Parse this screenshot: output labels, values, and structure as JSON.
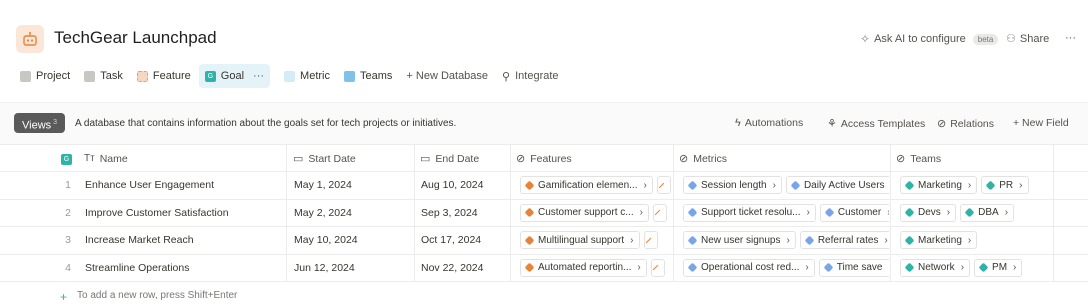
{
  "app": {
    "title": "TechGear Launchpad",
    "icon": "robot-icon"
  },
  "header": {
    "ask_ai": "Ask AI to configure",
    "beta": "beta",
    "share": "Share",
    "more": "···"
  },
  "tabs": [
    {
      "label": "Project",
      "color": "#c9c7c2"
    },
    {
      "label": "Task",
      "color": "#c9c7c2"
    },
    {
      "label": "Feature",
      "color": "#f0b99a"
    },
    {
      "label": "Goal",
      "color": "#2db3a8",
      "active": true,
      "more": "···"
    },
    {
      "label": "Metric",
      "color": "#bfe0f0"
    },
    {
      "label": "Teams",
      "color": "#7ec3e6"
    },
    {
      "label": "+ New Database"
    },
    {
      "label": "Integrate"
    }
  ],
  "toolbar": {
    "views": "Views",
    "views_count": "3",
    "description": "A database that contains information about the goals set for tech projects or initiatives.",
    "automations": "Automations",
    "access_templates": "Access Templates",
    "relations": "Relations",
    "new_field": "+ New Field"
  },
  "columns": {
    "name": "Name",
    "start_date": "Start Date",
    "end_date": "End Date",
    "features": "Features",
    "metrics": "Metrics",
    "teams": "Teams"
  },
  "rows": [
    {
      "num": "1",
      "name": "Enhance User Engagement",
      "start": "May 1, 2024",
      "end": "Aug 10, 2024",
      "features": [
        "Gamification elemen..."
      ],
      "metrics": [
        "Session length",
        "Daily Active Users"
      ],
      "teams": [
        "Marketing",
        "PR"
      ]
    },
    {
      "num": "2",
      "name": "Improve Customer Satisfaction",
      "start": "May 2, 2024",
      "end": "Sep 3, 2024",
      "features": [
        "Customer support c..."
      ],
      "metrics": [
        "Support ticket resolu...",
        "Customer"
      ],
      "teams": [
        "Devs",
        "DBA"
      ]
    },
    {
      "num": "3",
      "name": "Increase Market Reach",
      "start": "May 10, 2024",
      "end": "Oct 17, 2024",
      "features": [
        "Multilingual support"
      ],
      "metrics": [
        "New user signups",
        "Referral rates"
      ],
      "teams": [
        "Marketing"
      ]
    },
    {
      "num": "4",
      "name": "Streamline Operations",
      "start": "Jun 12, 2024",
      "end": "Nov 22, 2024",
      "features": [
        "Automated reportin..."
      ],
      "metrics": [
        "Operational cost red...",
        "Time save"
      ],
      "teams": [
        "Network",
        "PM"
      ]
    }
  ],
  "add_row": {
    "plus": "+",
    "label": "To add a new row, press Shift+Enter"
  }
}
